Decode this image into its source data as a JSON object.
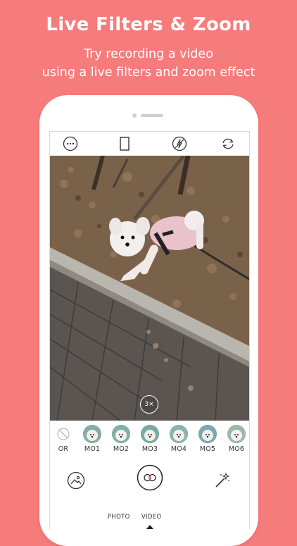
{
  "promo": {
    "title": "Live Filters & Zoom",
    "subtitle_line1": "Try recording a video",
    "subtitle_line2": "using a live filters and zoom effect"
  },
  "topbar": {
    "icons": [
      "more-icon",
      "aspect-ratio-icon",
      "flash-off-icon",
      "switch-camera-icon"
    ]
  },
  "viewfinder": {
    "zoom_level": "3×"
  },
  "filters": [
    {
      "label": "OR",
      "icon": "no-filter-icon"
    },
    {
      "label": "MO1"
    },
    {
      "label": "MO2"
    },
    {
      "label": "MO3"
    },
    {
      "label": "MO4"
    },
    {
      "label": "MO5"
    },
    {
      "label": "MO6"
    }
  ],
  "bottombar": {
    "gallery_icon": "gallery-icon",
    "shutter_icon": "video-record-icon",
    "effects_icon": "magic-wand-icon",
    "modes": [
      "PHOTO",
      "VIDEO"
    ],
    "selected_mode": "VIDEO"
  },
  "colors": {
    "background": "#f67b7b",
    "text_on_background": "#ffffff"
  }
}
